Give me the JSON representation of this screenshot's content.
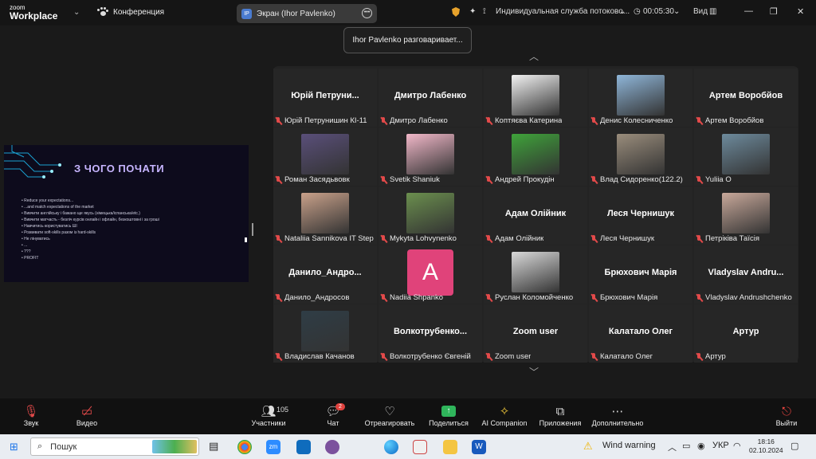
{
  "app": {
    "logo_line1": "zoom",
    "logo_line2": "Workplace",
    "conference_label": "Конференция",
    "screen_share_label": "Экран (Ihor Pavlenko)",
    "screen_share_badge": "IP",
    "stream_service": "Индивидуальная служба потоково...",
    "timer": "00:05:30",
    "view_label": "Вид",
    "speaking_tooltip": "Ihor Pavlenko разговаривает..."
  },
  "shared_slide": {
    "title": "З ЧОГО ПОЧАТИ",
    "bullets": [
      "Reduce your expectations...",
      "...and match expectations of the market",
      "Вивчити англійську і бажано ще якусь (німецька/іспанська/etc.)",
      "Вивчити матчасть - безліч курсів онлайн і офлайн, безкоштовні і за гроші",
      "Навчитись користуватись ШІ",
      "Розвивати soft-skills разом із hard-skills",
      "Не лінуватись",
      "...",
      "???",
      "PROFIT"
    ]
  },
  "participants": [
    {
      "big": "Юрій  Петруни...",
      "label": "Юрій Петрунишин КІ-11",
      "kind": "name"
    },
    {
      "big": "Дмитро Лабенко",
      "label": "Дмитро Лабенко",
      "kind": "name"
    },
    {
      "big": "",
      "label": "Коптяєва Катерина",
      "kind": "img",
      "color": "#f2f2f2"
    },
    {
      "big": "",
      "label": "Денис Колесниченко",
      "kind": "img",
      "color": "#8fb6d9"
    },
    {
      "big": "Артем Воробйов",
      "label": "Артем Воробйов",
      "kind": "name"
    },
    {
      "big": "",
      "label": "Роман Засядьвовк",
      "kind": "img",
      "color": "#5a4f7a"
    },
    {
      "big": "",
      "label": "Svetik Shaniuk",
      "kind": "img",
      "color": "#f2b8c9"
    },
    {
      "big": "",
      "label": "Андрей Прокудін",
      "kind": "img",
      "color": "#3fa33a"
    },
    {
      "big": "",
      "label": "Влад Сидоренко(122.2)",
      "kind": "img",
      "color": "#9a8d7c"
    },
    {
      "big": "",
      "label": "Yuliia O",
      "kind": "img",
      "color": "#6d8a9c"
    },
    {
      "big": "",
      "label": "Nataliia Sannikova IT Step",
      "kind": "img",
      "color": "#c9a18a"
    },
    {
      "big": "",
      "label": "Mykyta Lohvynenko",
      "kind": "img",
      "color": "#6b8f4e"
    },
    {
      "big": "Адам Олійник",
      "label": "Адам Олійник",
      "kind": "name"
    },
    {
      "big": "Леся Чернишук",
      "label": "Леся Чернишук",
      "kind": "name"
    },
    {
      "big": "",
      "label": "Петріківа Таїсія",
      "kind": "img",
      "color": "#c8a89a"
    },
    {
      "big": "Данило_Андро...",
      "label": "Данило_Андросов",
      "kind": "name"
    },
    {
      "big": "",
      "label": "Nadiia Shpanko",
      "kind": "avatar",
      "letter": "A"
    },
    {
      "big": "",
      "label": "Руслан Коломойченко",
      "kind": "img",
      "color": "#d9d9d9"
    },
    {
      "big": "Брюхович Марія",
      "label": "Брюхович Марія",
      "kind": "name"
    },
    {
      "big": "Vladyslav  Andru...",
      "label": "Vladyslav Andrushchenko",
      "kind": "name"
    },
    {
      "big": "",
      "label": "Владислав Качанов",
      "kind": "img",
      "color": "#2f3d46"
    },
    {
      "big": "Волкотрубенко...",
      "label": "Волкотрубенко Євгеній",
      "kind": "name"
    },
    {
      "big": "Zoom user",
      "label": "Zoom user",
      "kind": "name"
    },
    {
      "big": "Калатало Олег",
      "label": "Калатало Олег",
      "kind": "name"
    },
    {
      "big": "Артур",
      "label": "Артур",
      "kind": "name"
    }
  ],
  "toolbar": {
    "audio": "Звук",
    "video": "Видео",
    "participants": "Участники",
    "participants_count": "105",
    "chat": "Чат",
    "chat_badge": "2",
    "react": "Отреагировать",
    "share": "Поделиться",
    "ai": "AI Companion",
    "apps": "Приложения",
    "more": "Дополнительно",
    "leave": "Выйти"
  },
  "taskbar": {
    "search_placeholder": "Пошук",
    "weather": "Wind warning",
    "lang": "УКР",
    "time": "18:16",
    "date": "02.10.2024"
  },
  "colors": {
    "accent_share": "#2fb55b",
    "leave": "#e0423e",
    "weather_warning": "#f0b400"
  }
}
